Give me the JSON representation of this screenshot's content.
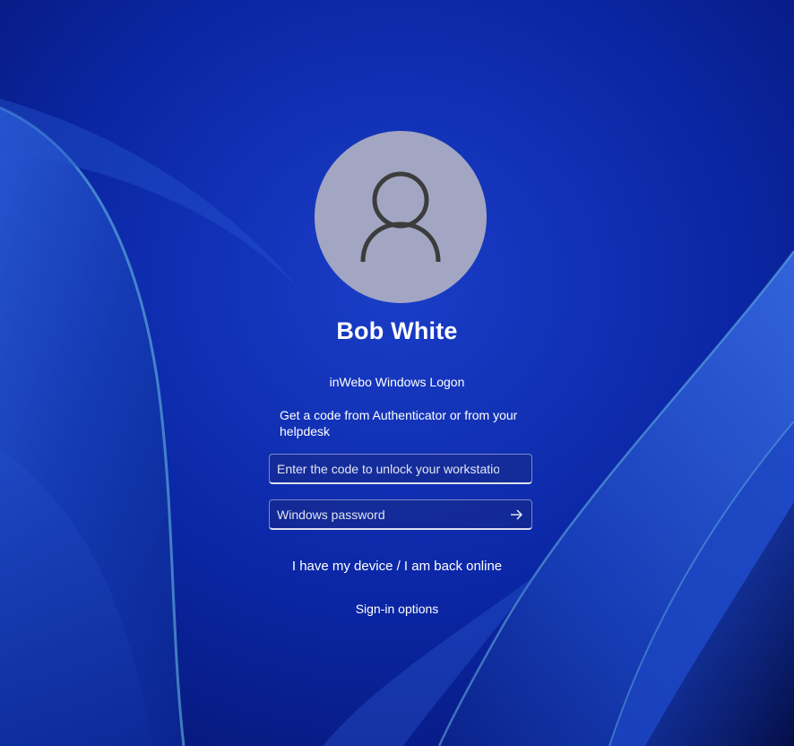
{
  "user": {
    "name": "Bob White",
    "avatar_icon": "person-icon"
  },
  "credential_provider": {
    "title": "inWebo Windows Logon",
    "instruction": "Get a code from Authenticator or from your helpdesk"
  },
  "code_field": {
    "value": "",
    "placeholder": "Enter the code to unlock your workstation"
  },
  "password_field": {
    "value": "",
    "placeholder": "Windows password",
    "submit_icon": "arrow-right-icon"
  },
  "links": {
    "back_online": "I have my device / I am back online",
    "sign_in_options": "Sign-in options"
  },
  "colors": {
    "background": "#0a1f8f",
    "avatar_bg": "#a2a6c2",
    "avatar_glyph": "#3c3c3c",
    "text": "#ffffff"
  }
}
